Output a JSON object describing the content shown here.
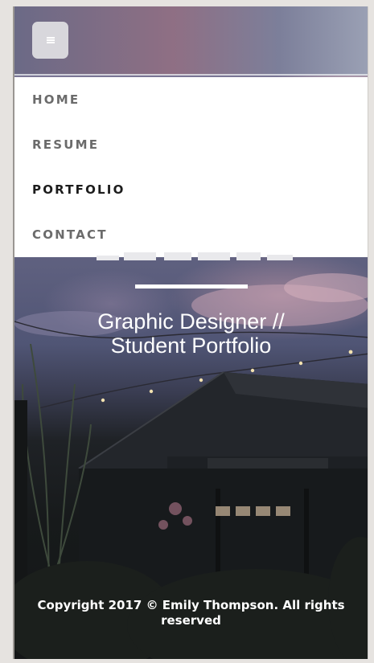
{
  "nav": {
    "toggle_icon": "hamburger-icon",
    "items": [
      {
        "label": "HOME",
        "active": false
      },
      {
        "label": "RESUME",
        "active": false
      },
      {
        "label": "PORTFOLIO",
        "active": true
      },
      {
        "label": "CONTACT",
        "active": false
      }
    ]
  },
  "hero": {
    "subtitle_line1": "Graphic Designer //",
    "subtitle_line2": "Student Portfolio"
  },
  "footer": {
    "copyright": "Copyright 2017 © Emily Thompson. All rights reserved"
  }
}
